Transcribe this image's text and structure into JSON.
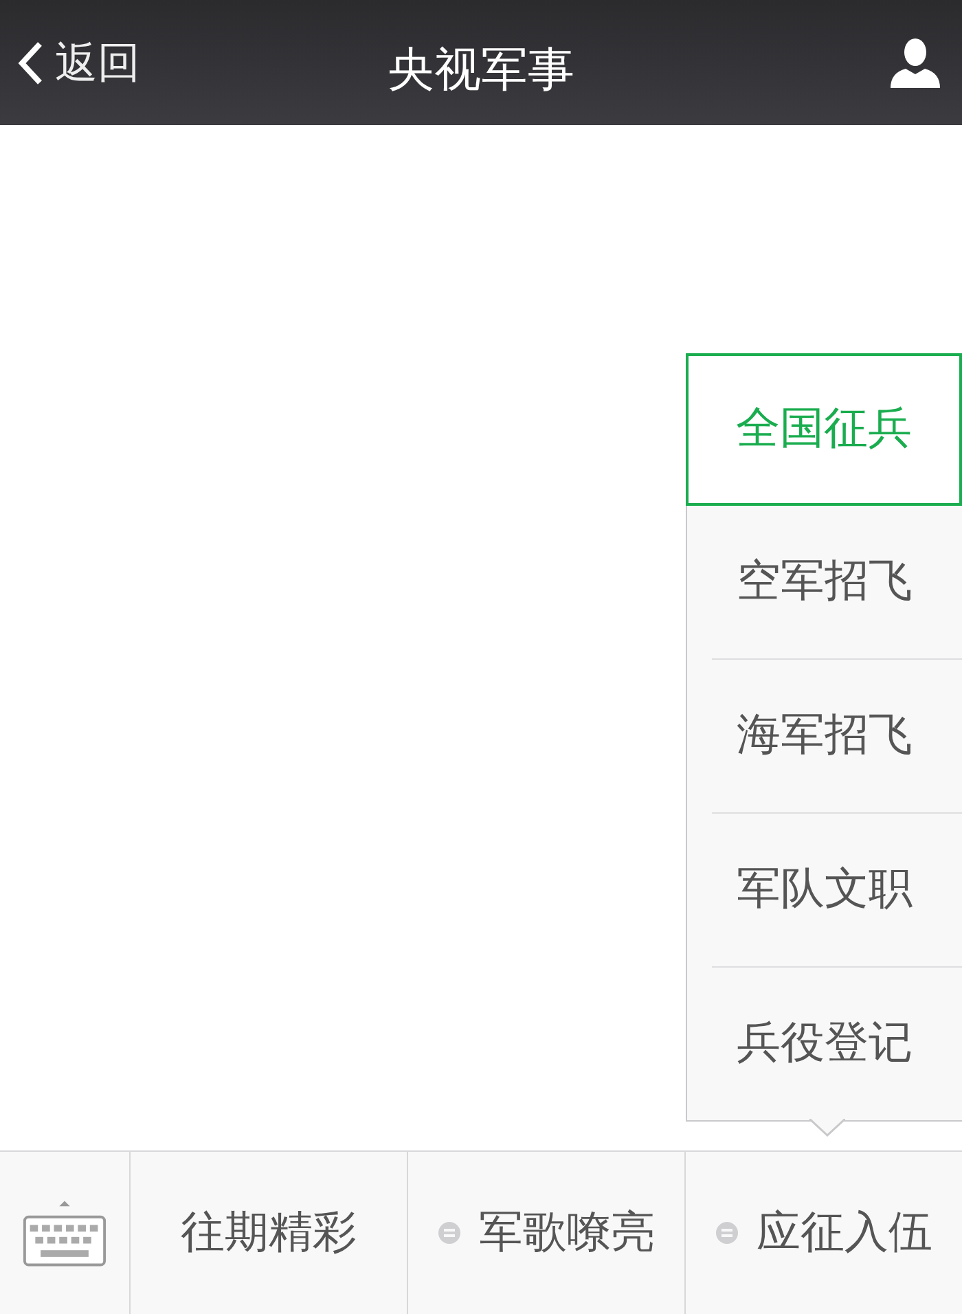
{
  "header": {
    "back_label": "返回",
    "title": "央视军事"
  },
  "popup_menu": [
    {
      "label": "全国征兵",
      "selected": true
    },
    {
      "label": "空军招飞",
      "selected": false
    },
    {
      "label": "海军招飞",
      "selected": false
    },
    {
      "label": "军队文职",
      "selected": false
    },
    {
      "label": "兵役登记",
      "selected": false
    }
  ],
  "bottom_menu": [
    {
      "label": "往期精彩",
      "has_submenu": false
    },
    {
      "label": "军歌嘹亮",
      "has_submenu": true
    },
    {
      "label": "应征入伍",
      "has_submenu": true
    }
  ]
}
